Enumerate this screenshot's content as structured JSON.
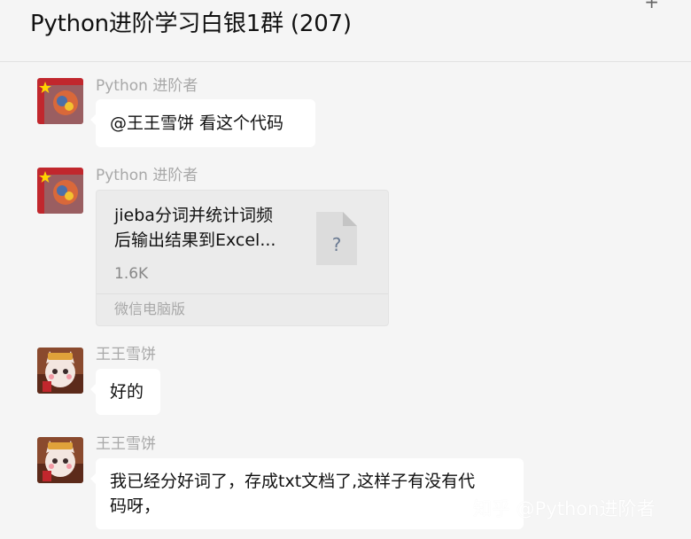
{
  "header": {
    "title": "Python进阶学习白银1群 (207)",
    "more_icon": "more-icon"
  },
  "messages": [
    {
      "sender": "Python 进阶者",
      "type": "text",
      "text": "@王王雪饼 看这个代码"
    },
    {
      "sender": "Python 进阶者",
      "type": "file",
      "file": {
        "name_line1": "jieba分词并统计词频",
        "name_line2": "后输出结果到Excel...",
        "size": "1.6K",
        "source": "微信电脑版",
        "icon": "unknown-file-icon",
        "icon_symbol": "?"
      }
    },
    {
      "sender": "王王雪饼",
      "type": "text",
      "text": "好的"
    },
    {
      "sender": "王王雪饼",
      "type": "text",
      "text_line1": "我已经分好词了，存成txt文档了,这样子有没有代",
      "text_line2": "码呀，"
    }
  ],
  "watermark": "知乎 @Python进阶者",
  "colors": {
    "background": "#f5f5f5",
    "bubble": "#ffffff",
    "file_card": "#ebebeb",
    "sender_name": "#a8a8a8"
  }
}
